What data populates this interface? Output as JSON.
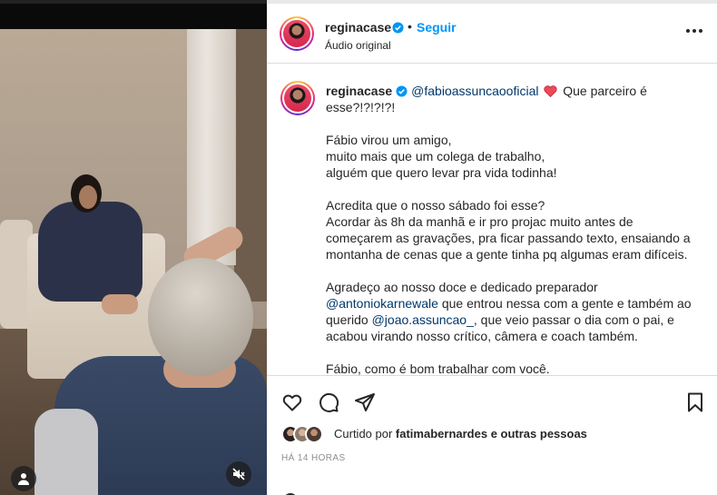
{
  "post": {
    "username": "reginacase",
    "follow_label": "Seguir",
    "separator": "•",
    "audio_label": "Áudio original"
  },
  "caption": {
    "username": "reginacase",
    "mention1": "@fabioassuncaooficial",
    "line1_rest": " Que parceiro é esse?!?!?!?!",
    "para1_line1": "Fábio virou um amigo,",
    "para1_line2": "muito mais que um colega de trabalho,",
    "para1_line3": "alguém que quero levar pra vida todinha!",
    "para2_line1": "Acredita que o nosso sábado foi esse?",
    "para2_line2": "Acordar às 8h da manhã e ir pro projac muito antes de começarem as gravações, pra ficar passando texto, ensaiando a montanha de cenas que a gente tinha pq algumas eram difíceis.",
    "para3_start": "Agradeço ao nosso doce e dedicado preparador ",
    "mention2": "@antoniokarnewale",
    "para3_mid": " que entrou nessa com a gente e também ao querido ",
    "mention3": "@joao.assuncao_",
    "para3_end": ", que veio passar o dia com o pai, e acabou virando nosso crítico, câmera e coach também.",
    "para4": "Fábio, como é bom trabalhar com você."
  },
  "likes": {
    "prefix": "Curtido por ",
    "user": "fatimabernardes",
    "suffix": " e outras pessoas"
  },
  "timestamp": "HÁ 14 HORAS",
  "icons": {
    "like": "heart-icon",
    "comment": "comment-icon",
    "share": "share-icon",
    "save": "bookmark-icon",
    "verified": "verified-badge-icon",
    "user_tag": "user-tag-icon",
    "mute": "muted-speaker-icon",
    "more": "more-options-icon"
  },
  "colors": {
    "follow_blue": "#0095f6",
    "mention": "#00376b",
    "verified": "#0095f6",
    "heart_red": "#ed4956"
  }
}
